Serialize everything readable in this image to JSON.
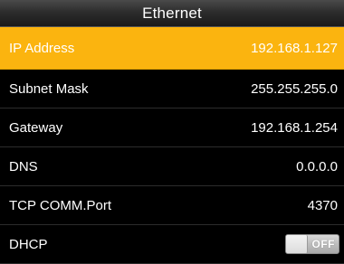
{
  "header": {
    "title": "Ethernet"
  },
  "settings": [
    {
      "label": "IP Address",
      "value": "192.168.1.127"
    },
    {
      "label": "Subnet Mask",
      "value": "255.255.255.0"
    },
    {
      "label": "Gateway",
      "value": "192.168.1.254"
    },
    {
      "label": "DNS",
      "value": "0.0.0.0"
    },
    {
      "label": "TCP COMM.Port",
      "value": "4370"
    },
    {
      "label": "DHCP",
      "toggle_text": "OFF",
      "toggle_on": false
    }
  ],
  "colors": {
    "selection": "#fbb40f",
    "background": "#000000",
    "text": "#ffffff"
  }
}
